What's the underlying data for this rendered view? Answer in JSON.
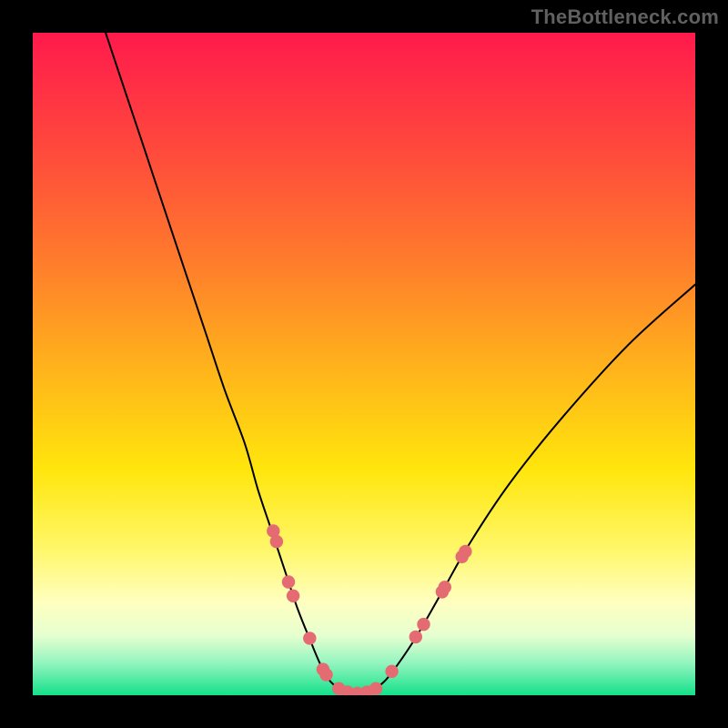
{
  "watermark": "TheBottleneck.com",
  "colors": {
    "frame": "#000000",
    "curve": "#000000",
    "marker": "#E46B72",
    "gradient_top": "#ff1a4c",
    "gradient_bottom": "#14e08a"
  },
  "chart_data": {
    "type": "line",
    "title": "",
    "xlabel": "",
    "ylabel": "",
    "xlim": [
      0,
      100
    ],
    "ylim": [
      0,
      100
    ],
    "grid": false,
    "series": [
      {
        "name": "bottleneck-curve",
        "x": [
          11,
          14,
          17,
          20,
          23,
          26,
          29,
          32,
          34,
          36,
          38,
          40,
          42,
          43.5,
          45,
          47,
          49,
          51,
          53,
          55,
          58,
          62,
          66,
          72,
          80,
          90,
          100
        ],
        "y": [
          100,
          91,
          82,
          73,
          64,
          55,
          46,
          38,
          31,
          25,
          19,
          13,
          8,
          4.5,
          2,
          0.7,
          0.3,
          0.7,
          2,
          4.5,
          9,
          16,
          23,
          32,
          42,
          53,
          62
        ]
      }
    ],
    "markers": {
      "name": "highlight-dots",
      "points": [
        {
          "x": 36.3,
          "y": 24.8
        },
        {
          "x": 36.8,
          "y": 23.2
        },
        {
          "x": 38.6,
          "y": 17.1
        },
        {
          "x": 39.3,
          "y": 15.0
        },
        {
          "x": 41.8,
          "y": 8.6
        },
        {
          "x": 43.8,
          "y": 3.9
        },
        {
          "x": 44.3,
          "y": 3.1
        },
        {
          "x": 46.2,
          "y": 1.0
        },
        {
          "x": 47.5,
          "y": 0.5
        },
        {
          "x": 49.0,
          "y": 0.3
        },
        {
          "x": 50.5,
          "y": 0.5
        },
        {
          "x": 51.8,
          "y": 1.0
        },
        {
          "x": 54.2,
          "y": 3.6
        },
        {
          "x": 57.8,
          "y": 8.8
        },
        {
          "x": 59.0,
          "y": 10.7
        },
        {
          "x": 61.8,
          "y": 15.6
        },
        {
          "x": 62.2,
          "y": 16.3
        },
        {
          "x": 64.8,
          "y": 20.9
        },
        {
          "x": 65.3,
          "y": 21.7
        }
      ]
    }
  }
}
